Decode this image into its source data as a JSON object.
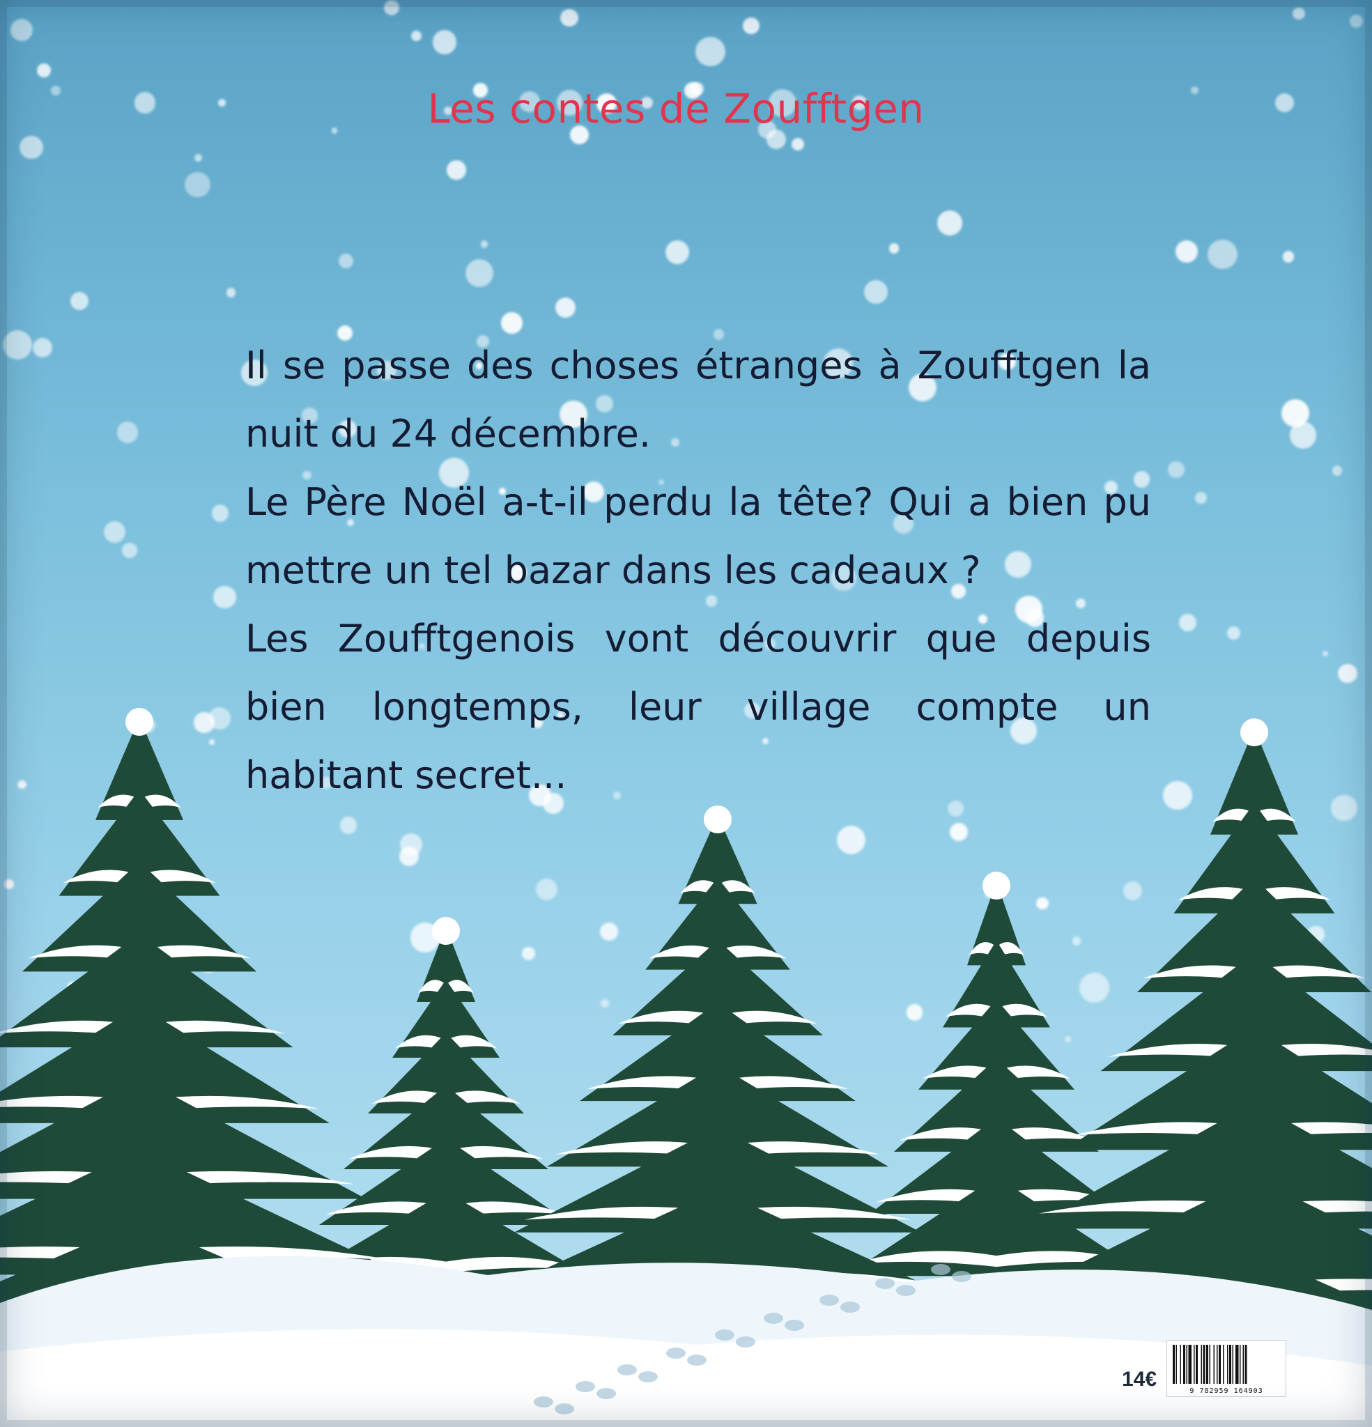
{
  "cover": {
    "series_title": "Les contes de Zoufftgen",
    "blurb": [
      "Il se passe des choses étranges à Zoufftgen la nuit du 24 décembre.",
      "Le Père Noël a-t-il perdu la tête? Qui a bien pu mettre un tel bazar dans les cadeaux ?",
      "Les Zoufftgenois vont découvrir que depuis bien longtemps, leur village compte un habitant secret..."
    ],
    "price": "14€",
    "isbn_digits": "9 782959 164903"
  },
  "colors": {
    "sky_top": "#5aa3c6",
    "sky_bottom": "#b9e1f1",
    "title": "#e0364d",
    "text": "#141c33",
    "tree": "#1f4a38",
    "snow": "#ffffff"
  }
}
